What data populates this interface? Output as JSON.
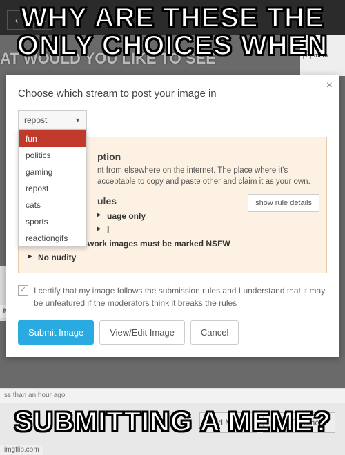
{
  "meme": {
    "top_text": "WHY ARE THESE THE ONLY CHOICES WHEN",
    "bottom_text": "SUBMITTING A MEME?",
    "watermark": "imgflip.com"
  },
  "toolbar": {
    "back_icon": "‹",
    "shuffle_icon": "⇄",
    "faded_bg_text": "AT WOULD YOU LIKE TO SEE"
  },
  "sidebar_right": {
    "checkbox_label": "mem",
    "checked": true
  },
  "modal": {
    "title": "Choose which stream to post your image in",
    "close": "×",
    "dropdown": {
      "selected": "repost",
      "caret": "▼",
      "options": [
        "fun",
        "politics",
        "gaming",
        "repost",
        "cats",
        "sports",
        "reactiongifs"
      ]
    },
    "description_heading": "ption",
    "description_text": "nt from elsewhere on the internet. The place where it's acceptable to copy and paste other and claim it as your own.",
    "rules_heading": "ules",
    "show_rules_btn": "show rule details",
    "rules": [
      "uage only",
      "l",
      "Not-safe-for-work images must be marked NSFW",
      "No nudity"
    ],
    "certify_text": "I certify that my image follows the submission rules and I understand that it may be unfeatured if the moderators think it breaks the rules",
    "certify_check": "✓",
    "buttons": {
      "submit": "Submit Image",
      "view": "View/Edit Image",
      "cancel": "Cancel"
    }
  },
  "below_modal": {
    "time_text": "ss than an hour ago"
  },
  "bottom_bar": {
    "add_meme": "Add Meme",
    "post_comment": "Post Comment"
  },
  "misc": {
    "m_badge": "M"
  }
}
